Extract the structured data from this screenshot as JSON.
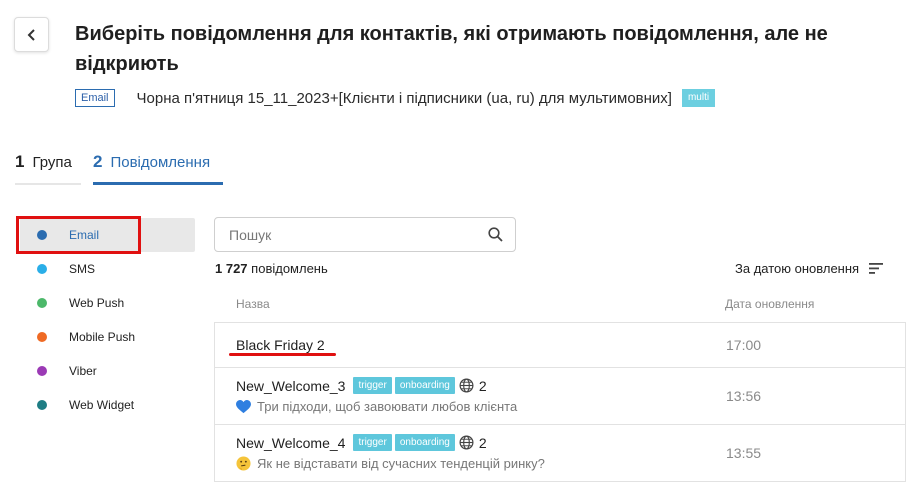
{
  "header": {
    "title": "Виберіть повідомлення для контактів, які отримають повідомлення, але не відкриють",
    "channel_tag": "Email",
    "campaign_name": "Чорна п'ятниця 15_11_2023+[Клієнти і підписники (ua, ru) для мультимовних]",
    "multi_tag": "multi"
  },
  "steps": [
    {
      "number": "1",
      "label": "Група"
    },
    {
      "number": "2",
      "label": "Повідомлення"
    }
  ],
  "channels": [
    {
      "label": "Email",
      "color": "#2b6cb0",
      "active": true
    },
    {
      "label": "SMS",
      "color": "#2aaee8"
    },
    {
      "label": "Web Push",
      "color": "#4cb86a"
    },
    {
      "label": "Mobile Push",
      "color": "#ef6a24"
    },
    {
      "label": "Viber",
      "color": "#9b3ab5"
    },
    {
      "label": "Web Widget",
      "color": "#1e7d84"
    }
  ],
  "search": {
    "placeholder": "Пошук"
  },
  "summary": {
    "count": "1 727",
    "count_label": "повідомлень",
    "sort_label": "За датою оновлення"
  },
  "columns": {
    "name": "Назва",
    "date": "Дата оновлення"
  },
  "messages": [
    {
      "name": "Black Friday 2",
      "time": "17:00"
    },
    {
      "name": "New_Welcome_3",
      "tag1": "trigger",
      "tag2": "onboarding",
      "langs": "2",
      "emoji": "blue-heart-icon",
      "desc": "Три підходи, щоб завоювати любов клієнта",
      "time": "13:56"
    },
    {
      "name": "New_Welcome_4",
      "tag1": "trigger",
      "tag2": "onboarding",
      "langs": "2",
      "emoji": "thinking-face-icon",
      "desc": "Як не відставати від сучасних тенденцій ринку?",
      "time": "13:55"
    }
  ],
  "colors": {
    "accent": "#2b6cb0",
    "tag": "#5ec7dc",
    "highlight": "#e01010"
  }
}
